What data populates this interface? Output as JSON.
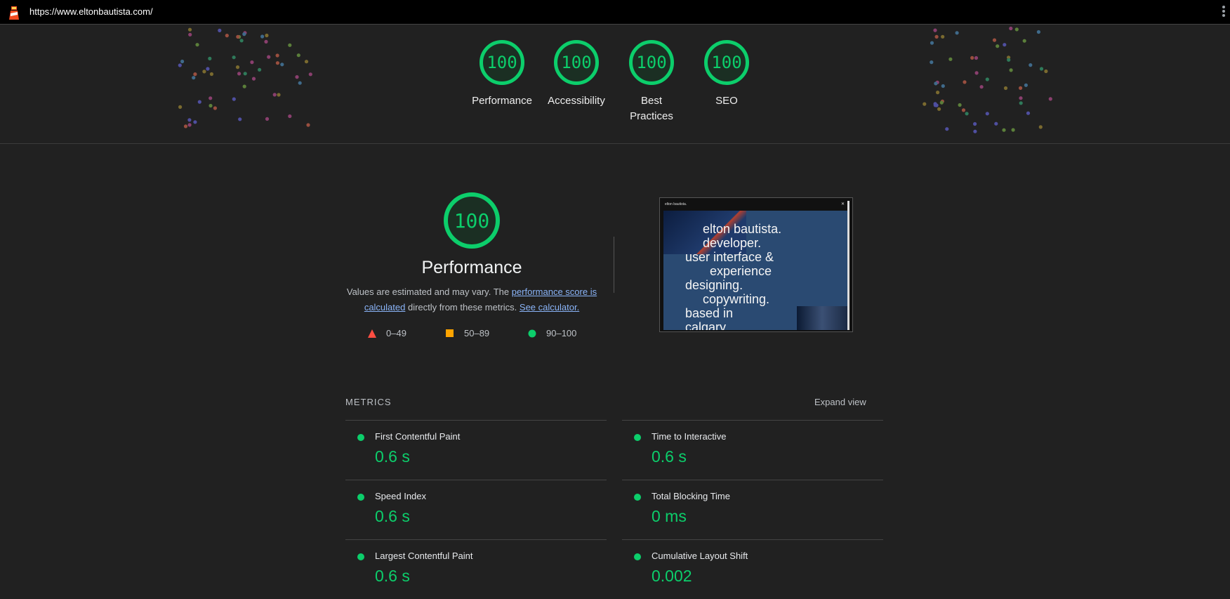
{
  "topbar": {
    "url": "https://www.eltonbautista.com/"
  },
  "categories": [
    {
      "score": "100",
      "label": "Performance"
    },
    {
      "score": "100",
      "label": "Accessibility"
    },
    {
      "score": "100",
      "label": "Best Practices"
    },
    {
      "score": "100",
      "label": "SEO"
    }
  ],
  "performance": {
    "score": "100",
    "title": "Performance",
    "desc_before": "Values are estimated and may vary. The ",
    "desc_link1": "performance score is calculated",
    "desc_middle": " directly from these metrics. ",
    "desc_link2": "See calculator.",
    "legend": [
      {
        "range": "0–49",
        "color": "#ff4e42",
        "shape": "triangle"
      },
      {
        "range": "50–89",
        "color": "#ffa400",
        "shape": "square"
      },
      {
        "range": "90–100",
        "color": "#0cce6b",
        "shape": "circle"
      }
    ]
  },
  "screenshot": {
    "site_title": "elton bautista.",
    "hero_text": "     elton bautista.\n     developer.\nuser interface &\n       experience\ndesigning.\n     copywriting.\nbased in\ncalgary."
  },
  "metrics": {
    "header": "METRICS",
    "expand_label": "Expand view",
    "items": [
      {
        "name": "First Contentful Paint",
        "value": "0.6 s"
      },
      {
        "name": "Time to Interactive",
        "value": "0.6 s"
      },
      {
        "name": "Speed Index",
        "value": "0.6 s"
      },
      {
        "name": "Total Blocking Time",
        "value": "0 ms"
      },
      {
        "name": "Largest Contentful Paint",
        "value": "0.6 s"
      },
      {
        "name": "Cumulative Layout Shift",
        "value": "0.002"
      }
    ]
  },
  "colors": {
    "pass": "#0cce6b",
    "background": "#212121"
  }
}
